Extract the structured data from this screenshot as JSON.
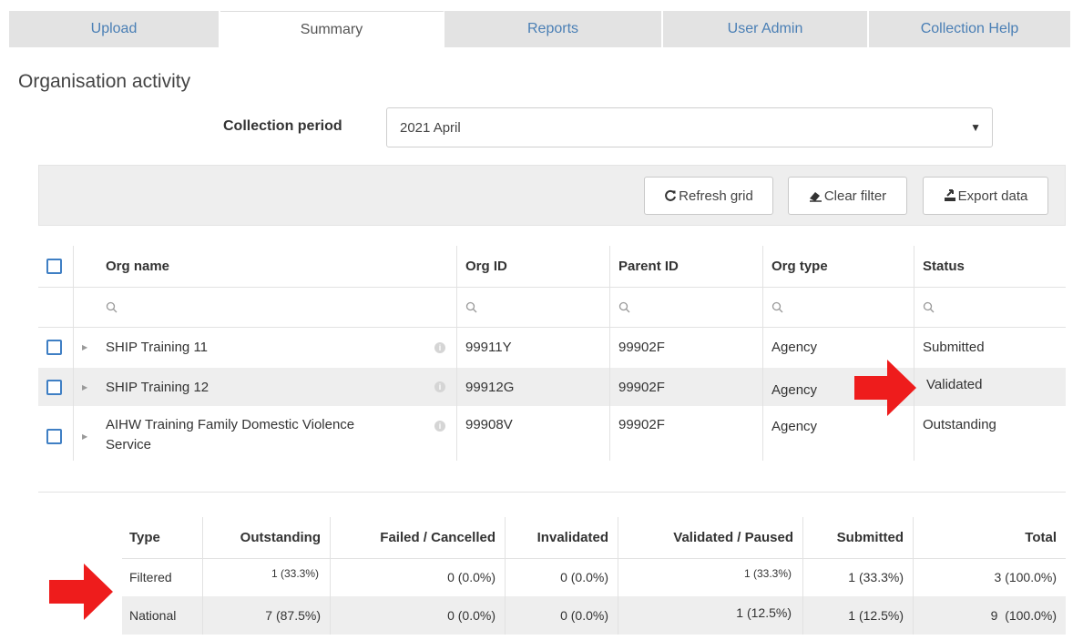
{
  "tabs": [
    {
      "label": "Upload",
      "active": false
    },
    {
      "label": "Summary",
      "active": true
    },
    {
      "label": "Reports",
      "active": false
    },
    {
      "label": "User Admin",
      "active": false
    },
    {
      "label": "Collection Help",
      "active": false
    }
  ],
  "page_title": "Organisation activity",
  "collection_period": {
    "label": "Collection period",
    "value": "2021 April"
  },
  "toolbar": {
    "refresh_label": "Refresh grid",
    "clear_label": "Clear filter",
    "export_label": "Export data"
  },
  "grid": {
    "columns": [
      "Org name",
      "Org ID",
      "Parent ID",
      "Org type",
      "Status"
    ],
    "rows": [
      {
        "org_name": "SHIP Training 11",
        "org_id": "99911Y",
        "parent_id": "99902F",
        "org_type": "Agency",
        "status": "Submitted"
      },
      {
        "org_name": "SHIP Training 12",
        "org_id": "99912G",
        "parent_id": "99902F",
        "org_type": "Agency",
        "status": "Validated"
      },
      {
        "org_name_line1": "AIHW Training Family Domestic Violence",
        "org_name_line2": "Service",
        "org_id": "99908V",
        "parent_id": "99902F",
        "org_type": "Agency",
        "status": "Outstanding"
      }
    ]
  },
  "summary": {
    "columns": [
      "Type",
      "Outstanding",
      "Failed / Cancelled",
      "Invalidated",
      "Validated / Paused",
      "Submitted",
      "Total"
    ],
    "rows": [
      {
        "type": "Filtered",
        "outstanding": "1 (33.3%)",
        "failed": "0 (0.0%)",
        "invalidated": "0 (0.0%)",
        "validated": "1 (33.3%)",
        "submitted": "1 (33.3%)",
        "total": "3 (100.0%)"
      },
      {
        "type": "National",
        "outstanding": "7 (87.5%)",
        "failed": "0 (0.0%)",
        "invalidated": "0 (0.0%)",
        "validated": "1 (12.5%)",
        "submitted": "1 (12.5%)",
        "total": "9  (100.0%)"
      }
    ]
  },
  "colors": {
    "link": "#4a7fb5",
    "checkbox": "#3f7fc4",
    "arrow": "#ee1c1c",
    "row_highlight": "#eeeeee"
  },
  "icons": {
    "refresh": "refresh-icon",
    "clear": "eraser-icon",
    "export": "export-icon",
    "search": "search-icon",
    "info": "info-icon"
  }
}
